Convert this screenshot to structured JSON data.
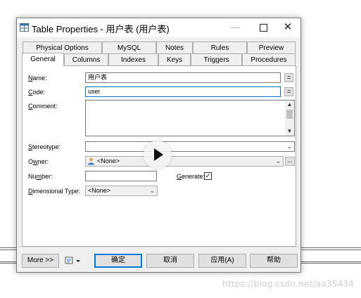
{
  "window": {
    "title": "Table Properties - 用户表 (用户表)",
    "minimize": "—",
    "close": "✕"
  },
  "tabs_row1": [
    "Physical Options",
    "MySQL",
    "Notes",
    "Rules",
    "Preview"
  ],
  "tabs_row2": [
    "General",
    "Columns",
    "Indexes",
    "Keys",
    "Triggers",
    "Procedures"
  ],
  "active_tab": "General",
  "form": {
    "name_label_key": "N",
    "name_label_rest": "ame:",
    "name_value": "用户表",
    "code_label_key": "C",
    "code_label_rest": "ode:",
    "code_value": "user",
    "comment_label_key": "C",
    "comment_label_rest": "omment:",
    "comment_value": "",
    "stereotype_label_key": "S",
    "stereotype_label_rest": "tereotype:",
    "stereotype_value": "",
    "owner_label_pre": "O",
    "owner_label_key": "w",
    "owner_label_rest": "ner:",
    "owner_value": "<None>",
    "number_label_pre": "Nu",
    "number_label_key": "m",
    "number_label_rest": "ber:",
    "number_value": "",
    "generate_label_key": "G",
    "generate_label_rest": "enerate:",
    "generate_checked": true,
    "check_mark": "✓",
    "dimensional_label_key": "D",
    "dimensional_label_rest": "imensional Type:",
    "dimensional_value": "<None>",
    "equals_btn": "=",
    "ellipsis_btn": "...",
    "dropdown_arrow": "⌄"
  },
  "buttons": {
    "more": "More >>",
    "ok": "确定",
    "cancel": "取消",
    "apply": "应用(A)",
    "help": "帮助"
  },
  "overlay": {
    "watermark": "https://blog.csdn.net/aa35434"
  },
  "colors": {
    "focus_border": "#0078d7",
    "dialog_bg": "#f0f0f0"
  }
}
